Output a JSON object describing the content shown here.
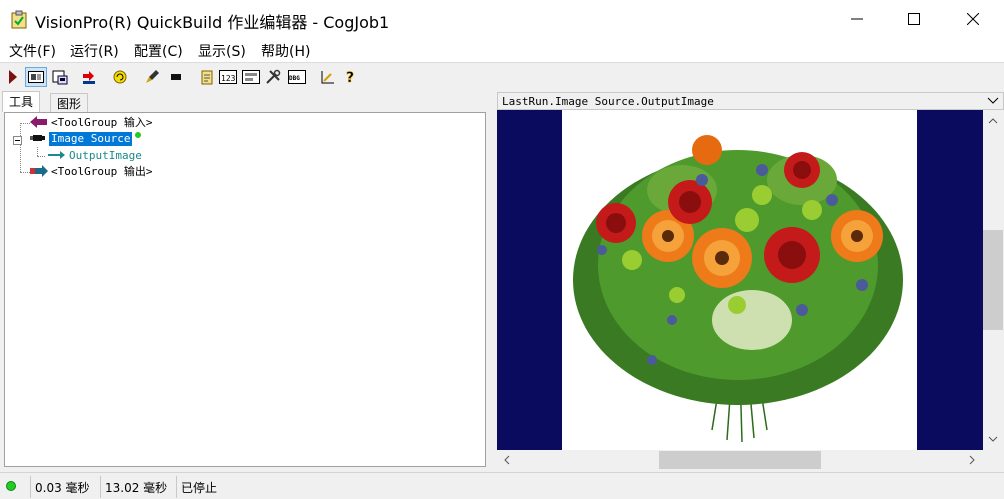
{
  "window": {
    "title": "VisionPro(R) QuickBuild 作业编辑器 - CogJob1",
    "app_icon": "clipboard-check-icon",
    "controls": [
      "minimize-icon",
      "maximize-icon",
      "close-icon"
    ]
  },
  "menu": {
    "items": [
      {
        "label": "文件(F)"
      },
      {
        "label": "运行(R)"
      },
      {
        "label": "配置(C)"
      },
      {
        "label": "显示(S)"
      },
      {
        "label": "帮助(H)"
      }
    ]
  },
  "toolbar": {
    "buttons": [
      "run-icon",
      "display-icon",
      "save-load-icon",
      "import-icon",
      "refresh-icon",
      "brush-icon",
      "terminal-icon",
      "edit-script-icon",
      "counter-icon",
      "form-icon",
      "tools-icon",
      "debug-icon",
      "measure-icon",
      "help-icon"
    ]
  },
  "tabs": [
    {
      "label": "工具"
    },
    {
      "label": "图形"
    }
  ],
  "tree": {
    "items": [
      {
        "label": "<ToolGroup 输入>"
      },
      {
        "label": "Image Source"
      },
      {
        "label": "OutputImage"
      },
      {
        "label": "<ToolGroup 输出>"
      }
    ]
  },
  "image_display": {
    "header": "LastRun.Image Source.OutputImage",
    "content": "flower-bouquet-image"
  },
  "status": {
    "cells": [
      {
        "text": "0.03 毫秒"
      },
      {
        "text": "13.02 毫秒"
      },
      {
        "text": "已停止"
      }
    ],
    "indicator_color": "#22cc22"
  },
  "colors": {
    "image_background": "#0a0a5e",
    "selection": "#0078d7"
  }
}
